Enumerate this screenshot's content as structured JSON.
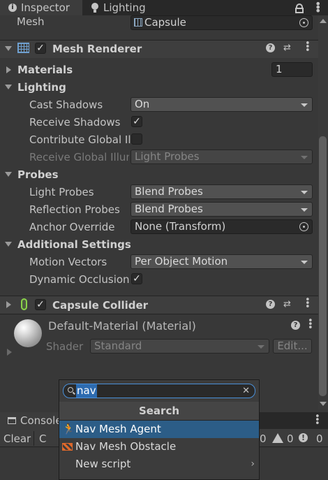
{
  "tabs": {
    "inspector": "Inspector",
    "lighting": "Lighting"
  },
  "mesh_row": {
    "label": "Mesh",
    "value": "Capsule"
  },
  "mesh_renderer": {
    "title": "Mesh Renderer",
    "materials_label": "Materials",
    "materials_count": "1",
    "lighting_label": "Lighting",
    "cast_shadows_label": "Cast Shadows",
    "cast_shadows_value": "On",
    "receive_shadows_label": "Receive Shadows",
    "contribute_gi_label": "Contribute Global Ill",
    "receive_gi_label": "Receive Global Illum",
    "receive_gi_value": "Light Probes",
    "probes_label": "Probes",
    "light_probes_label": "Light Probes",
    "light_probes_value": "Blend Probes",
    "reflection_probes_label": "Reflection Probes",
    "reflection_probes_value": "Blend Probes",
    "anchor_override_label": "Anchor Override",
    "anchor_override_value": "None (Transform)",
    "additional_label": "Additional Settings",
    "motion_vectors_label": "Motion Vectors",
    "motion_vectors_value": "Per Object Motion",
    "dynamic_occlusion_label": "Dynamic Occlusion"
  },
  "capsule_collider": {
    "title": "Capsule Collider"
  },
  "material": {
    "title": "Default-Material (Material)",
    "shader_label": "Shader",
    "shader_value": "Standard",
    "edit_label": "Edit..."
  },
  "console": {
    "tab": "Console",
    "clear": "Clear",
    "warn_count": "0",
    "error_count": "0",
    "info_count": "0"
  },
  "popup": {
    "search_value": "nav",
    "header": "Search",
    "items": [
      "Nav Mesh Agent",
      "Nav Mesh Obstacle",
      "New script"
    ]
  },
  "colors": {
    "selected": "#2c5d87",
    "accent_orange": "#e0682a",
    "collider_green": "#8ad34a"
  }
}
